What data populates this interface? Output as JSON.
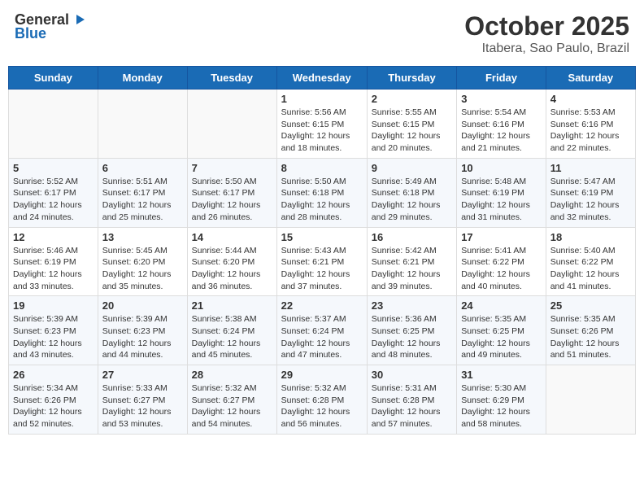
{
  "header": {
    "logo_general": "General",
    "logo_blue": "Blue",
    "month": "October 2025",
    "location": "Itabera, Sao Paulo, Brazil"
  },
  "days_of_week": [
    "Sunday",
    "Monday",
    "Tuesday",
    "Wednesday",
    "Thursday",
    "Friday",
    "Saturday"
  ],
  "weeks": [
    [
      {
        "day": "",
        "info": ""
      },
      {
        "day": "",
        "info": ""
      },
      {
        "day": "",
        "info": ""
      },
      {
        "day": "1",
        "info": "Sunrise: 5:56 AM\nSunset: 6:15 PM\nDaylight: 12 hours\nand 18 minutes."
      },
      {
        "day": "2",
        "info": "Sunrise: 5:55 AM\nSunset: 6:15 PM\nDaylight: 12 hours\nand 20 minutes."
      },
      {
        "day": "3",
        "info": "Sunrise: 5:54 AM\nSunset: 6:16 PM\nDaylight: 12 hours\nand 21 minutes."
      },
      {
        "day": "4",
        "info": "Sunrise: 5:53 AM\nSunset: 6:16 PM\nDaylight: 12 hours\nand 22 minutes."
      }
    ],
    [
      {
        "day": "5",
        "info": "Sunrise: 5:52 AM\nSunset: 6:17 PM\nDaylight: 12 hours\nand 24 minutes."
      },
      {
        "day": "6",
        "info": "Sunrise: 5:51 AM\nSunset: 6:17 PM\nDaylight: 12 hours\nand 25 minutes."
      },
      {
        "day": "7",
        "info": "Sunrise: 5:50 AM\nSunset: 6:17 PM\nDaylight: 12 hours\nand 26 minutes."
      },
      {
        "day": "8",
        "info": "Sunrise: 5:50 AM\nSunset: 6:18 PM\nDaylight: 12 hours\nand 28 minutes."
      },
      {
        "day": "9",
        "info": "Sunrise: 5:49 AM\nSunset: 6:18 PM\nDaylight: 12 hours\nand 29 minutes."
      },
      {
        "day": "10",
        "info": "Sunrise: 5:48 AM\nSunset: 6:19 PM\nDaylight: 12 hours\nand 31 minutes."
      },
      {
        "day": "11",
        "info": "Sunrise: 5:47 AM\nSunset: 6:19 PM\nDaylight: 12 hours\nand 32 minutes."
      }
    ],
    [
      {
        "day": "12",
        "info": "Sunrise: 5:46 AM\nSunset: 6:19 PM\nDaylight: 12 hours\nand 33 minutes."
      },
      {
        "day": "13",
        "info": "Sunrise: 5:45 AM\nSunset: 6:20 PM\nDaylight: 12 hours\nand 35 minutes."
      },
      {
        "day": "14",
        "info": "Sunrise: 5:44 AM\nSunset: 6:20 PM\nDaylight: 12 hours\nand 36 minutes."
      },
      {
        "day": "15",
        "info": "Sunrise: 5:43 AM\nSunset: 6:21 PM\nDaylight: 12 hours\nand 37 minutes."
      },
      {
        "day": "16",
        "info": "Sunrise: 5:42 AM\nSunset: 6:21 PM\nDaylight: 12 hours\nand 39 minutes."
      },
      {
        "day": "17",
        "info": "Sunrise: 5:41 AM\nSunset: 6:22 PM\nDaylight: 12 hours\nand 40 minutes."
      },
      {
        "day": "18",
        "info": "Sunrise: 5:40 AM\nSunset: 6:22 PM\nDaylight: 12 hours\nand 41 minutes."
      }
    ],
    [
      {
        "day": "19",
        "info": "Sunrise: 5:39 AM\nSunset: 6:23 PM\nDaylight: 12 hours\nand 43 minutes."
      },
      {
        "day": "20",
        "info": "Sunrise: 5:39 AM\nSunset: 6:23 PM\nDaylight: 12 hours\nand 44 minutes."
      },
      {
        "day": "21",
        "info": "Sunrise: 5:38 AM\nSunset: 6:24 PM\nDaylight: 12 hours\nand 45 minutes."
      },
      {
        "day": "22",
        "info": "Sunrise: 5:37 AM\nSunset: 6:24 PM\nDaylight: 12 hours\nand 47 minutes."
      },
      {
        "day": "23",
        "info": "Sunrise: 5:36 AM\nSunset: 6:25 PM\nDaylight: 12 hours\nand 48 minutes."
      },
      {
        "day": "24",
        "info": "Sunrise: 5:35 AM\nSunset: 6:25 PM\nDaylight: 12 hours\nand 49 minutes."
      },
      {
        "day": "25",
        "info": "Sunrise: 5:35 AM\nSunset: 6:26 PM\nDaylight: 12 hours\nand 51 minutes."
      }
    ],
    [
      {
        "day": "26",
        "info": "Sunrise: 5:34 AM\nSunset: 6:26 PM\nDaylight: 12 hours\nand 52 minutes."
      },
      {
        "day": "27",
        "info": "Sunrise: 5:33 AM\nSunset: 6:27 PM\nDaylight: 12 hours\nand 53 minutes."
      },
      {
        "day": "28",
        "info": "Sunrise: 5:32 AM\nSunset: 6:27 PM\nDaylight: 12 hours\nand 54 minutes."
      },
      {
        "day": "29",
        "info": "Sunrise: 5:32 AM\nSunset: 6:28 PM\nDaylight: 12 hours\nand 56 minutes."
      },
      {
        "day": "30",
        "info": "Sunrise: 5:31 AM\nSunset: 6:28 PM\nDaylight: 12 hours\nand 57 minutes."
      },
      {
        "day": "31",
        "info": "Sunrise: 5:30 AM\nSunset: 6:29 PM\nDaylight: 12 hours\nand 58 minutes."
      },
      {
        "day": "",
        "info": ""
      }
    ]
  ]
}
